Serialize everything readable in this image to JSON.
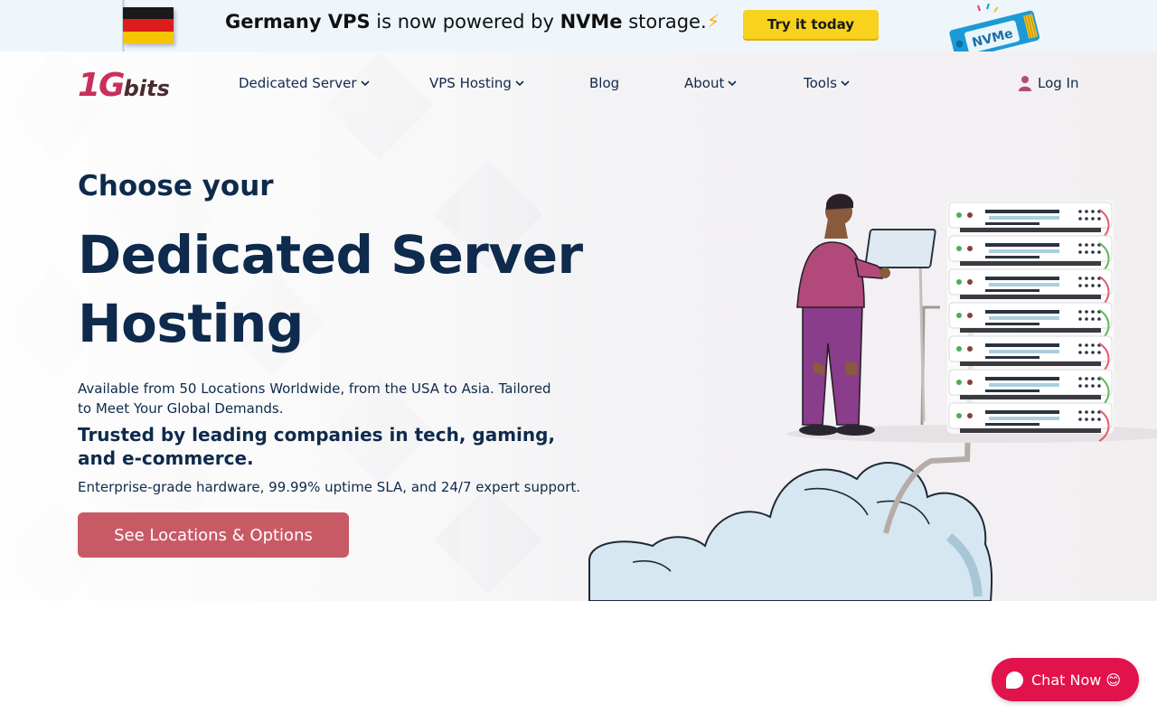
{
  "promo": {
    "text_part1": "Germany VPS",
    "text_part2": " is now powered by ",
    "text_part3": "NVMe",
    "text_part4": " storage.",
    "bolt": "⚡",
    "button_label": "Try it today",
    "chip_label": "NVMe"
  },
  "brand": {
    "logo_num": "1G",
    "logo_text": "bits"
  },
  "nav": {
    "items": [
      {
        "label": "Dedicated Server"
      },
      {
        "label": "VPS Hosting"
      },
      {
        "label": "Blog"
      },
      {
        "label": "About"
      },
      {
        "label": "Tools"
      }
    ],
    "login": "Log In"
  },
  "hero": {
    "kicker": "Choose your",
    "title": "Dedicated Server Hosting",
    "sub1": "Available from 50 Locations Worldwide, from the USA to Asia. Tailored to Meet Your Global Demands.",
    "sub2": "Trusted by leading companies in tech, gaming, and e-commerce.",
    "sub3": "Enterprise-grade hardware, 99.99% uptime SLA, and 24/7 expert support.",
    "cta": "See Locations & Options"
  },
  "chat": {
    "label": "Chat Now 😊"
  },
  "colors": {
    "brand_red": "#c7315a",
    "cta": "#c85a66",
    "chat": "#e2124d",
    "heading": "#0e2a4c",
    "promo_button": "#f8d21c"
  }
}
